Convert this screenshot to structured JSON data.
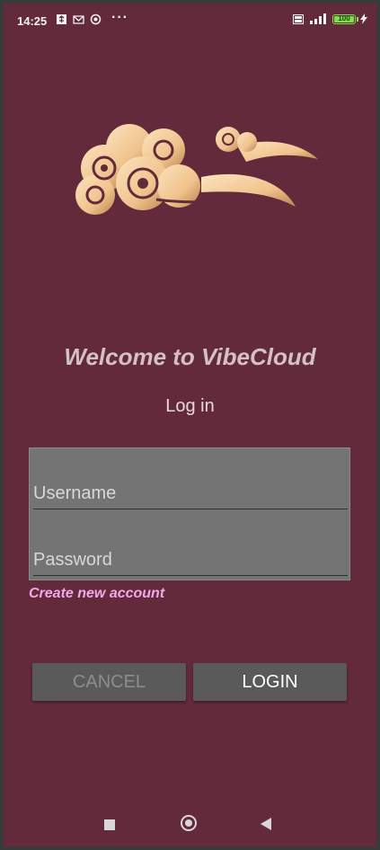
{
  "status_bar": {
    "time": "14:25",
    "left_icons": [
      "usb-icon",
      "gmail-icon",
      "sync-icon"
    ],
    "more": "···",
    "right_icons": [
      "volte-icon",
      "signal-4g-icon"
    ],
    "battery_level": "100"
  },
  "app": {
    "welcome": "Welcome to VibeCloud",
    "heading": "Log in"
  },
  "form": {
    "username_placeholder": "Username",
    "password_placeholder": "Password",
    "create_account": "Create new account"
  },
  "buttons": {
    "cancel": "CANCEL",
    "login": "LOGIN"
  },
  "colors": {
    "background": "#632a3b",
    "form_box": "#747474",
    "link": "#f1a9e9",
    "button": "#5a5a5a",
    "logo_light": "#f7d9b0",
    "logo_dark": "#8a5a2e"
  },
  "nav_bar": [
    "recents-icon",
    "home-icon",
    "back-icon"
  ]
}
